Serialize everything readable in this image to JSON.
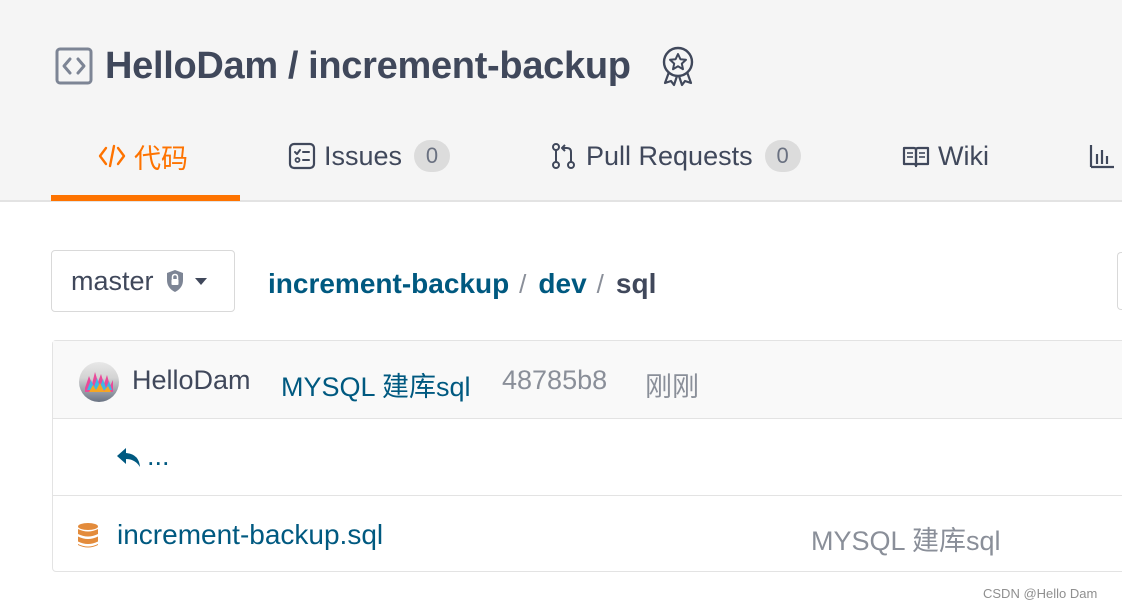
{
  "repo": {
    "owner": "HelloDam",
    "separator": "/",
    "name": "increment-backup"
  },
  "tabs": [
    {
      "label": "代码",
      "icon": "code-icon",
      "active": true
    },
    {
      "label": "Issues",
      "icon": "issues-icon",
      "count": "0"
    },
    {
      "label": "Pull Requests",
      "icon": "pull-request-icon",
      "count": "0"
    },
    {
      "label": "Wiki",
      "icon": "book-icon"
    },
    {
      "label": "",
      "icon": "bar-chart-icon"
    }
  ],
  "branch": {
    "name": "master",
    "icons": [
      "lock-icon",
      "caret-down-icon"
    ]
  },
  "breadcrumb": {
    "items": [
      "increment-backup",
      "dev"
    ],
    "separator": "/",
    "current": "sql"
  },
  "commit": {
    "author": "HelloDam",
    "message": "MYSQL 建库sql",
    "sha": "48785b8",
    "time": "刚刚"
  },
  "parent": {
    "label": "...",
    "icon": "reply-arrow-icon"
  },
  "files": [
    {
      "name": "increment-backup.sql",
      "commit_message": "MYSQL 建库sql",
      "icon": "database-icon"
    }
  ],
  "watermark": "CSDN @Hello Dam",
  "colors": {
    "accent": "#fe7300",
    "link": "#005980",
    "text": "#40485b",
    "muted": "#8a8f99",
    "header_bg": "#f5f5f5",
    "database_icon": "#e38b3b"
  }
}
